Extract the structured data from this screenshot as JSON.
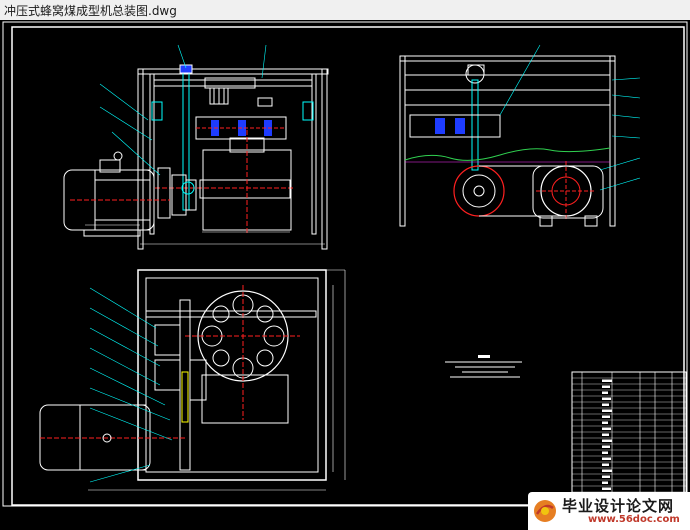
{
  "window": {
    "title": "冲压式蜂窝煤成型机总装图.dwg"
  },
  "watermark": {
    "site_name": "毕业设计论文网",
    "site_url": "www.56doc.com"
  },
  "colors": {
    "background": "#000000",
    "frame": "#ffffff",
    "annotation": "#00ffff",
    "dimension": "#ffffff",
    "centerline": "#ff2020",
    "highlight_red": "#ff0000",
    "accent_yellow": "#ffff00",
    "accent_blue": "#1e3cff",
    "accent_green": "#30d050",
    "accent_magenta": "#ff33ff"
  }
}
